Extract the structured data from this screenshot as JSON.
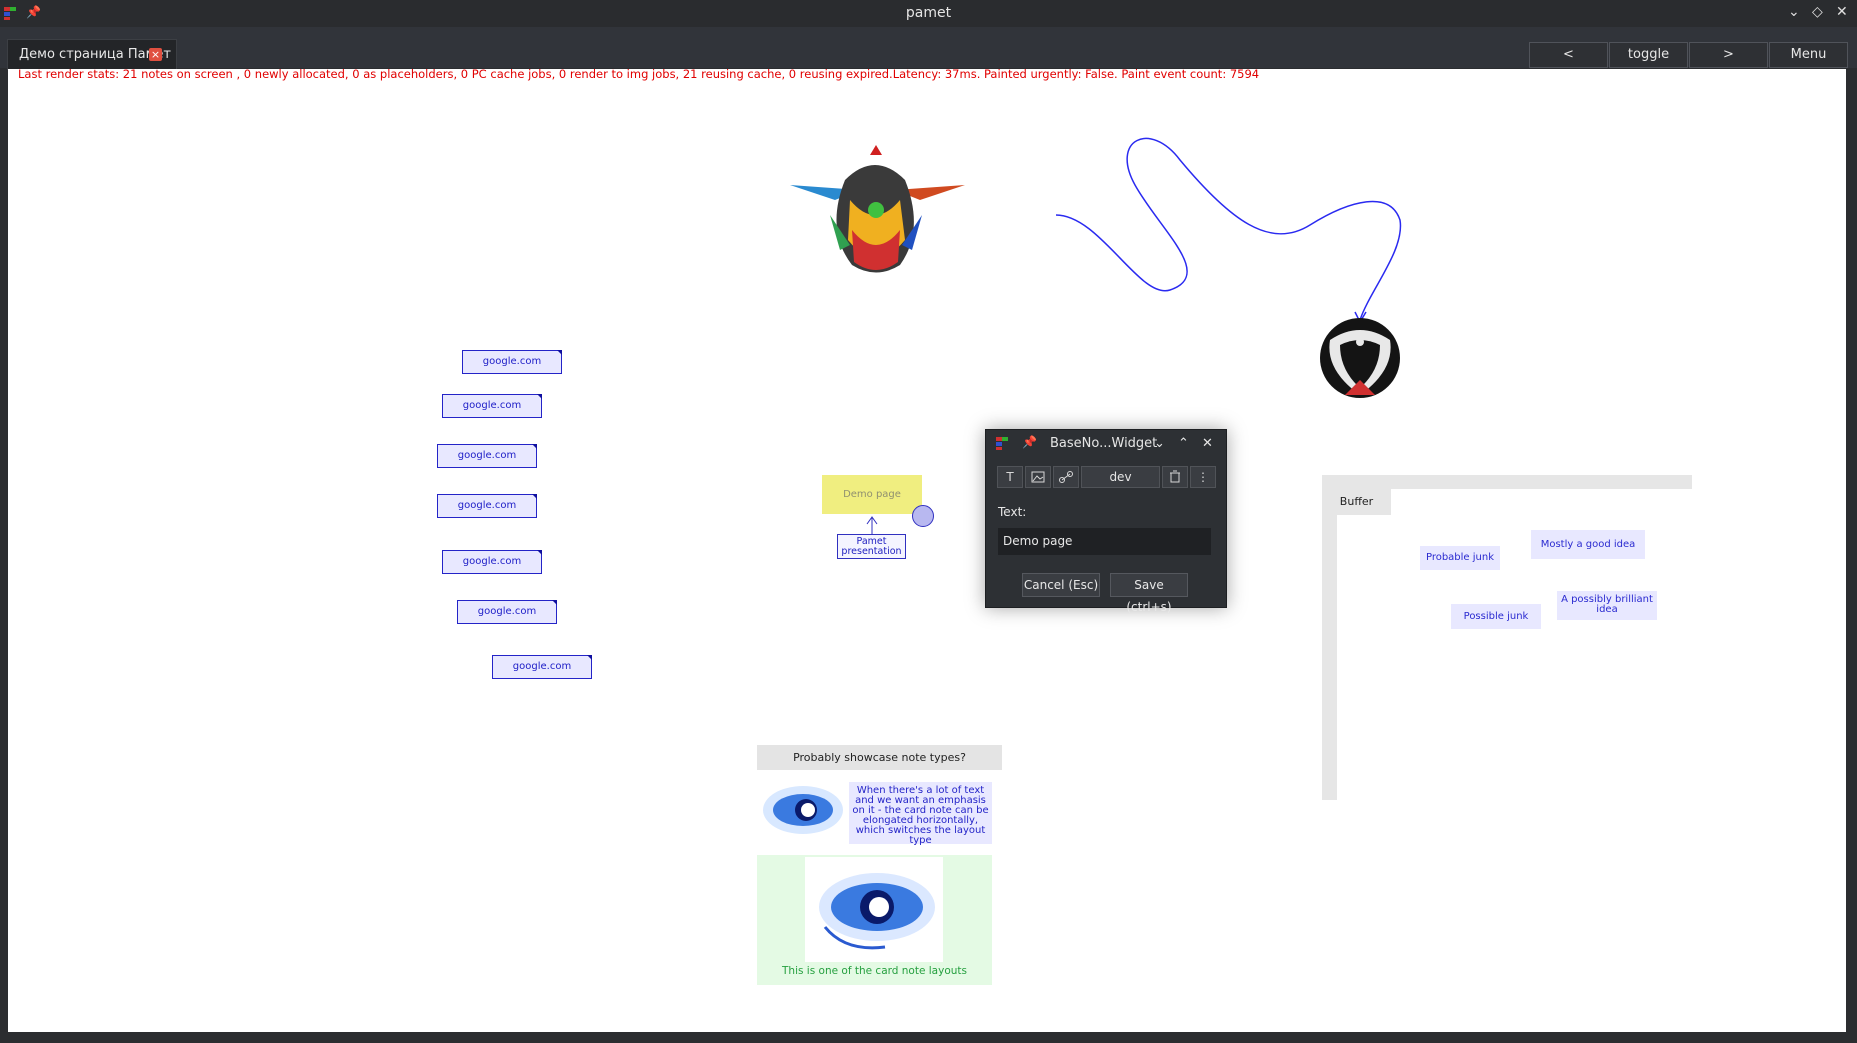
{
  "window": {
    "title": "pamet"
  },
  "tab": {
    "label": "Демо страница Памет",
    "close_glyph": "×"
  },
  "nav": {
    "back": "<",
    "toggle": "toggle",
    "forward": ">",
    "menu": "Menu"
  },
  "stats": "Last render stats: 21 notes on screen , 0 newly allocated, 0 as placeholders, 0 PC cache jobs, 0 render to img jobs, 21 reusing cache, 0 reusing expired.Latency: 37ms. Painted urgently: False. Paint event count: 7594",
  "link_notes": [
    "google.com",
    "google.com",
    "google.com",
    "google.com",
    "google.com",
    "google.com",
    "google.com"
  ],
  "demo_note": "Demo page",
  "pamet_note": "Pamet presentation",
  "buffer": {
    "label": "Buffer",
    "notes": [
      "Probable junk",
      "Mostly a good idea",
      "Possible junk",
      "A possibly brilliant idea"
    ]
  },
  "showcase": {
    "header": "Probably showcase note types?",
    "card_text": "When there's a lot of text and we want an emphasis on it - the card note can be elongated horizontally, which switches the layout type",
    "card_caption": "This is one of the card note layouts"
  },
  "dialog": {
    "title": "BaseNo...Widget",
    "tool_text": "T",
    "tag": "dev",
    "text_label": "Text:",
    "text_value": "Demo page",
    "cancel": "Cancel (Esc)",
    "save": "Save (ctrl+s)"
  },
  "colors": {
    "stats": "#e00000",
    "link": "#2020c8",
    "accent": "#3030c0"
  }
}
